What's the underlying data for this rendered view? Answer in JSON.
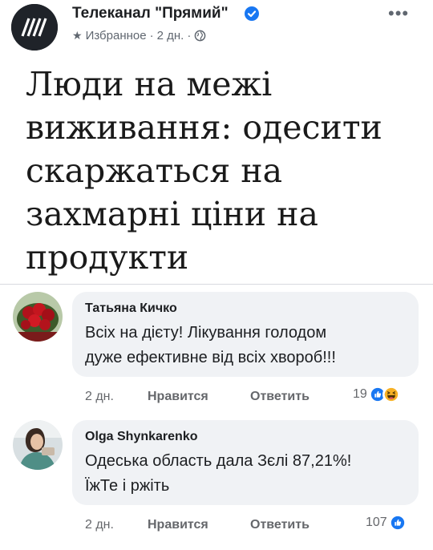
{
  "post": {
    "page_name": "Телеканал \"Прямий\"",
    "meta": {
      "favorites_label": "Избранное",
      "separator1": "·",
      "time": "2 дн.",
      "separator2": "·"
    },
    "headline": "Люди на межі виживання: одесити скаржаться на захмарні ціни на продукти"
  },
  "colors": {
    "verified_badge": "#1877f2",
    "like_blue": "#1877f2",
    "haha_yellow": "#f7b125",
    "bubble_bg": "#f0f2f5"
  },
  "icons": {
    "page_avatar": "striped-logo-icon",
    "verified": "verified-check-icon",
    "more": "more-horizontal-icon",
    "favorites": "star-icon",
    "audience": "globe-icon",
    "like_reaction": "thumbs-up-icon",
    "haha_reaction": "laughing-face-icon"
  },
  "comments": [
    {
      "author": "Татьяна Кичко",
      "text_lines": [
        "Всіх на дієту! Лікування голодом",
        "дуже ефективне від всіх хвороб!!!"
      ],
      "time": "2 дн.",
      "like_label": "Нравится",
      "reply_label": "Ответить",
      "reaction_count": "19"
    },
    {
      "author": "Olga Shynkarenko",
      "text_lines": [
        "Одеська область дала Зєлі 87,21%!",
        "ЇжТе і ржіть"
      ],
      "time": "2 дн.",
      "like_label": "Нравится",
      "reply_label": "Ответить",
      "reaction_count": "107"
    }
  ]
}
